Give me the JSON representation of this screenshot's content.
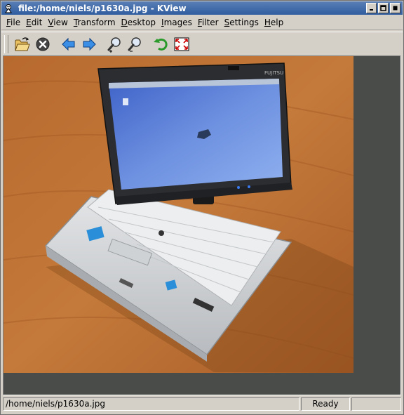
{
  "window": {
    "title": "file:/home/niels/p1630a.jpg - KView",
    "app_icon": "kview-app-icon",
    "controls": [
      "minimize-icon",
      "maximize-icon",
      "close-icon"
    ]
  },
  "menu": {
    "items": [
      {
        "first": "F",
        "rest": "ile"
      },
      {
        "first": "E",
        "rest": "dit"
      },
      {
        "first": "V",
        "rest": "iew"
      },
      {
        "first": "T",
        "rest": "ransform"
      },
      {
        "first": "D",
        "rest": "esktop"
      },
      {
        "first": "I",
        "rest": "mages"
      },
      {
        "first": "F",
        "rest": "ilter"
      },
      {
        "first": "S",
        "rest": "ettings"
      },
      {
        "first": "H",
        "rest": "elp"
      }
    ]
  },
  "toolbar": {
    "icons": [
      "open-folder-icon",
      "stop-icon",
      "back-arrow-icon",
      "forward-arrow-icon",
      "zoom-in-icon",
      "zoom-out-icon",
      "rotate-icon",
      "fullscreen-icon"
    ]
  },
  "photo": {
    "subject": "convertible laptop on wooden table",
    "brand_text": "FUJITSU"
  },
  "statusbar": {
    "path": "/home/niels/p1630a.jpg",
    "status": "Ready",
    "extra": ""
  },
  "colors": {
    "titlebar": "#2f5d9f",
    "chrome": "#d4d0c8",
    "viewport_bg": "#4a4c4a"
  }
}
